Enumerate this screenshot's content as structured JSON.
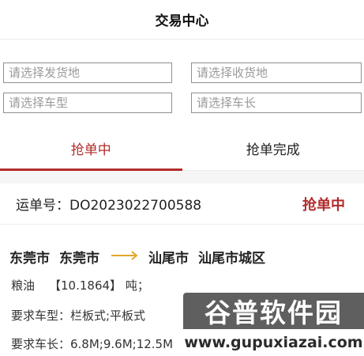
{
  "header": {
    "title": "交易中心"
  },
  "filters": {
    "origin_placeholder": "请选择发货地",
    "destination_placeholder": "请选择收货地",
    "vehicle_type_placeholder": "请选择车型",
    "vehicle_length_placeholder": "请选择车长"
  },
  "tabs": [
    {
      "label": "抢单中",
      "active": true
    },
    {
      "label": "抢单完成",
      "active": false
    }
  ],
  "order": {
    "number_text": "运单号：DO2023022700588",
    "status": "抢单中",
    "origin_city": "东莞市",
    "origin_district": "东莞市",
    "destination_city": "汕尾市",
    "destination_district": "汕尾市城区",
    "cargo_name": "粮油",
    "cargo_weight": "【10.1864】",
    "cargo_unit": "吨；",
    "vehicle_type_text": "要求车型：栏板式;平板式",
    "vehicle_length_text": "要求车长：6.8M;9.6M;12.5M"
  },
  "watermark": {
    "title": "谷普软件园",
    "url": "www.gupuxiazai.com"
  },
  "colors": {
    "accent": "#b22b2b",
    "arrow": "#e3a82b",
    "input_border": "#8f8f8f",
    "placeholder": "#9a9a9a"
  }
}
